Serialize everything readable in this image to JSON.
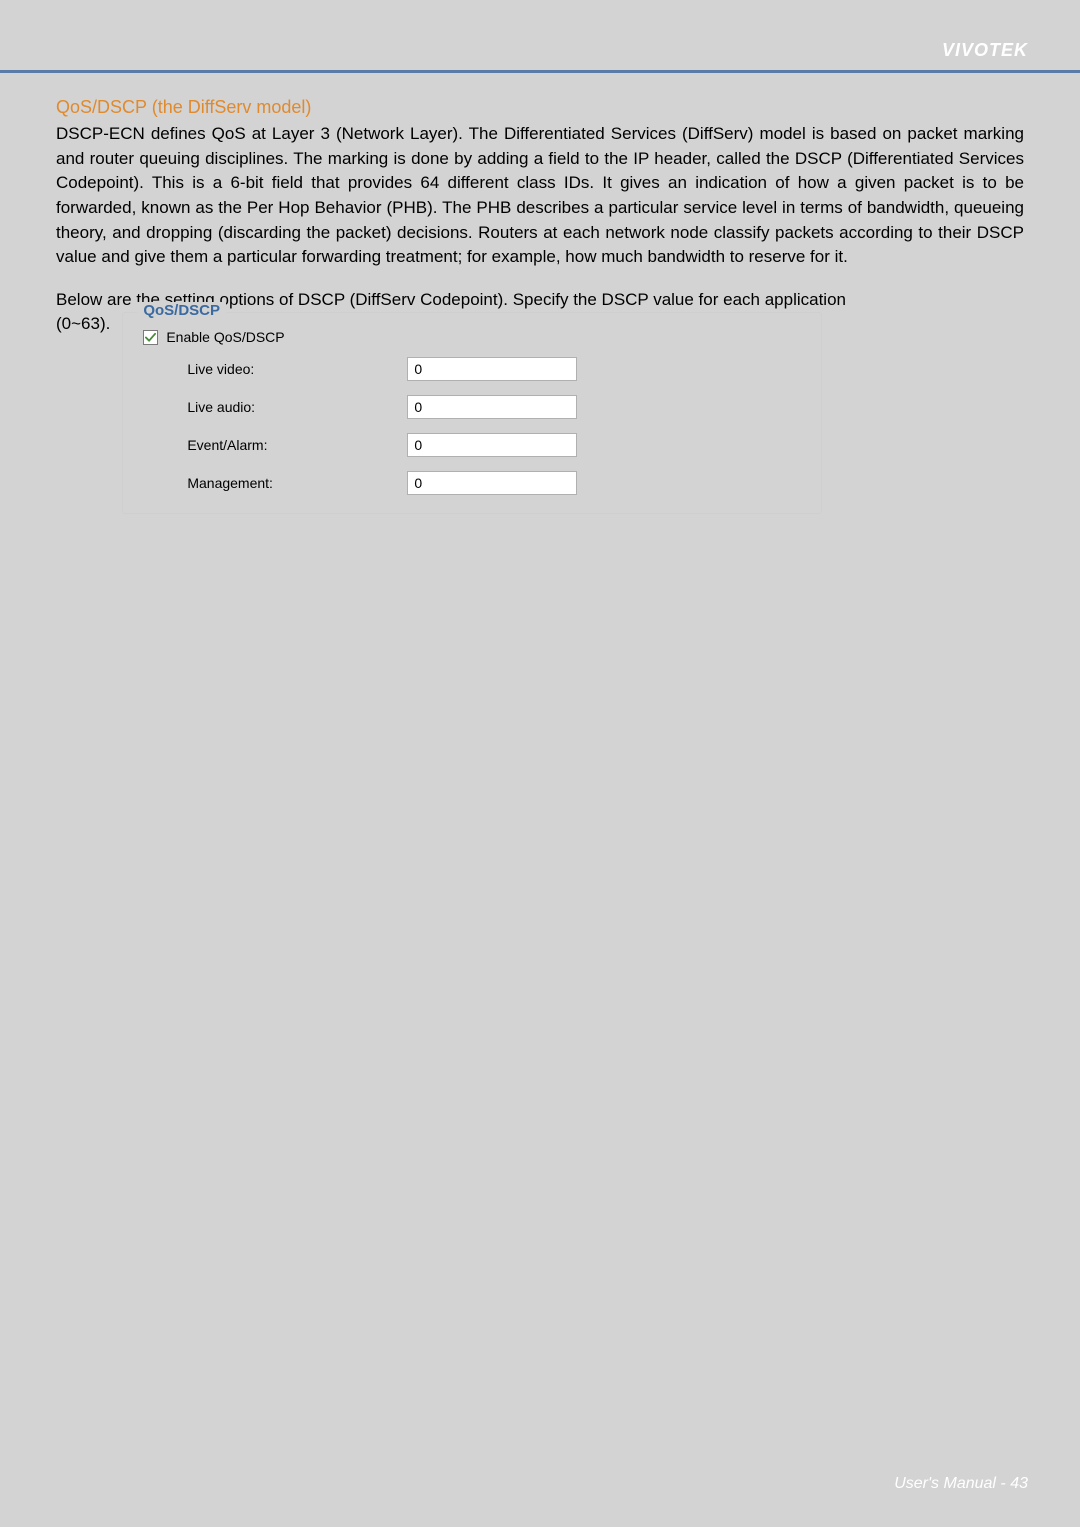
{
  "brand": "VIVOTEK",
  "section_title": "QoS/DSCP (the DiffServ model)",
  "para1": "DSCP-ECN defines QoS at Layer 3 (Network Layer). The Differentiated Services (DiffServ) model is based on packet marking and router queuing disciplines. The marking is done by adding a field to the IP header, called the DSCP (Differentiated Services Codepoint). This is a 6-bit field that provides 64 different class IDs. It gives an indication of how a given packet is to be forwarded, known as the Per Hop Behavior (PHB). The PHB describes a particular service level in terms of bandwidth, queueing theory, and dropping (discarding the packet) decisions. Routers at each network node classify packets according to their DSCP value and give them a particular forwarding treatment; for example, how much bandwidth to reserve for it.",
  "para2": "Below are the setting options of DSCP (DiffServ Codepoint). Specify the DSCP value for each application (0~63).",
  "range_label": "(0~63).",
  "para2_main": "Below are the setting options of DSCP (DiffServ Codepoint). Specify the DSCP value for each application",
  "panel": {
    "legend": "QoS/DSCP",
    "checkbox_label": "Enable QoS/DSCP",
    "checkbox_checked": true,
    "rows": [
      {
        "label": "Live video:",
        "value": "0"
      },
      {
        "label": "Live audio:",
        "value": "0"
      },
      {
        "label": "Event/Alarm:",
        "value": "0"
      },
      {
        "label": "Management:",
        "value": "0"
      }
    ]
  },
  "footer": "User's Manual - 43"
}
